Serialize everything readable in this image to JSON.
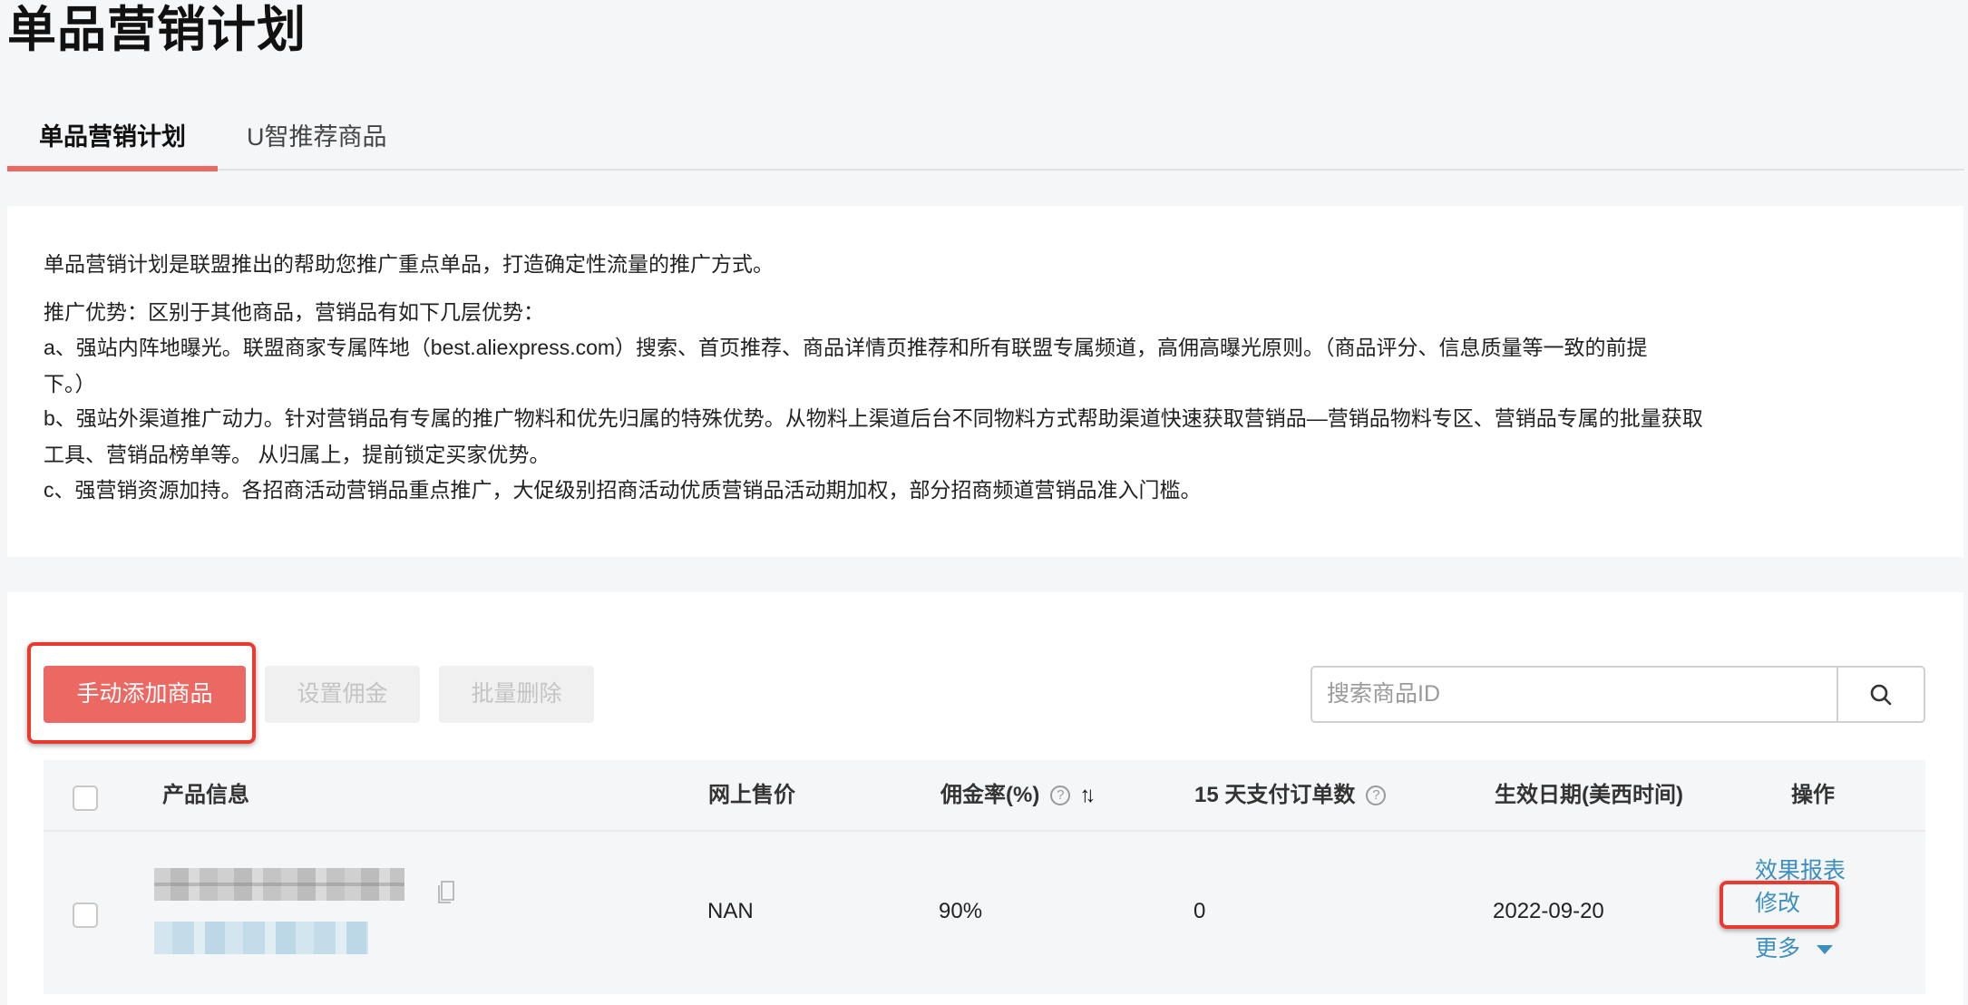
{
  "page": {
    "title": "单品营销计划"
  },
  "tabs": [
    {
      "label": "单品营销计划",
      "active": true
    },
    {
      "label": "U智推荐商品",
      "active": false
    }
  ],
  "intro": {
    "lines": [
      "单品营销计划是联盟推出的帮助您推广重点单品，打造确定性流量的推广方式。",
      "推广优势：区别于其他商品，营销品有如下几层优势：",
      "a、强站内阵地曝光。联盟商家专属阵地（best.aliexpress.com）搜索、首页推荐、商品详情页推荐和所有联盟专属频道，高佣高曝光原则。（商品评分、信息质量等一致的前提",
      "下。）",
      "b、强站外渠道推广动力。针对营销品有专属的推广物料和优先归属的特殊优势。从物料上渠道后台不同物料方式帮助渠道快速获取营销品—营销品物料专区、营销品专属的批量获取",
      "工具、营销品榜单等。 从归属上，提前锁定买家优势。",
      "c、强营销资源加持。各招商活动营销品重点推广，大促级别招商活动优质营销品活动期加权，部分招商频道营销品准入门槛。"
    ]
  },
  "toolbar": {
    "add_label": "手动添加商品",
    "set_commission_label": "设置佣金",
    "batch_delete_label": "批量删除",
    "search_placeholder": "搜索商品ID",
    "search_icon": "search-icon"
  },
  "table": {
    "headers": {
      "product": "产品信息",
      "price": "网上售价",
      "commission": "佣金率(%)",
      "orders": "15 天支付订单数",
      "date": "生效日期(美西时间)",
      "actions": "操作"
    },
    "sort_icon": "⇅",
    "help_icon": "?",
    "rows": [
      {
        "product_name": "[redacted]",
        "product_link": "[redacted]",
        "price": "NAN",
        "commission": "90%",
        "orders": "0",
        "date": "2022-09-20",
        "actions": {
          "report": "效果报表",
          "edit": "修改",
          "more": "更多"
        }
      }
    ]
  },
  "colors": {
    "accent": "#ec6862",
    "link": "#3d8fc0",
    "highlight": "#e83a2e",
    "background": "#f5f6f8"
  }
}
